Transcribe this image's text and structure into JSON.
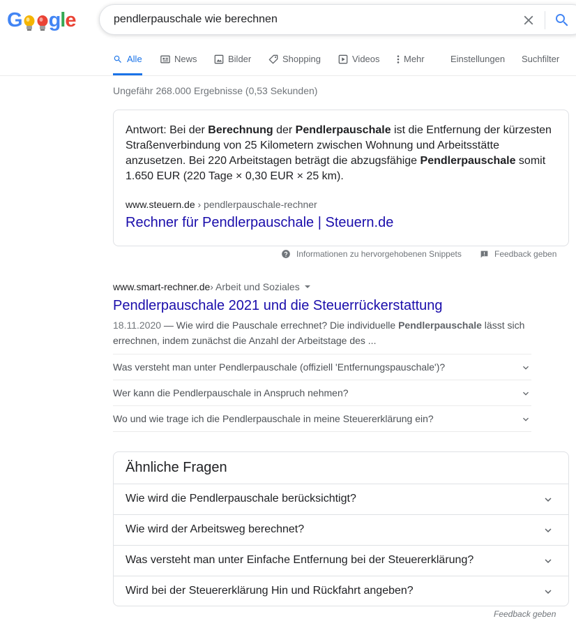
{
  "logo": {
    "letters": [
      "G",
      "o",
      "o",
      "g",
      "l",
      "e"
    ]
  },
  "search": {
    "query": "pendlerpauschale wie berechnen"
  },
  "tabs": [
    {
      "label": "Alle",
      "icon": "search-icon"
    },
    {
      "label": "News",
      "icon": "news-icon"
    },
    {
      "label": "Bilder",
      "icon": "image-icon"
    },
    {
      "label": "Shopping",
      "icon": "tag-icon"
    },
    {
      "label": "Videos",
      "icon": "play-icon"
    },
    {
      "label": "Mehr",
      "icon": "more-vert-icon"
    }
  ],
  "tools": {
    "settings": "Einstellungen",
    "filter": "Suchfilter"
  },
  "result_stats": "Ungefähr 268.000 Ergebnisse (0,53 Sekunden)",
  "featured_snippet": {
    "t1": "Antwort: Bei der ",
    "b1": "Berechnung",
    "t2": " der ",
    "b2": "Pendlerpauschale",
    "t3": " ist die Entfernung der kürzesten Straßenverbindung von 25 Kilometern zwischen Wohnung und Arbeitsstätte anzusetzen. Bei 220 Arbeitstagen beträgt die abzugsfähige ",
    "b3": "Pendlerpauschale",
    "t4": " somit 1.650 EUR (220 Tage × 0,30 EUR × 25 km).",
    "cite_domain": "www.steuern.de",
    "cite_path": " › pendlerpauschale-rechner",
    "title": "Rechner für Pendlerpauschale | Steuern.de",
    "info": "Informationen zu hervorgehobenen Snippets",
    "feedback": "Feedback geben"
  },
  "result": {
    "cite_domain": "www.smart-rechner.de",
    "cite_path": " › Arbeit und Soziales",
    "title": "Pendlerpauschale 2021 und die Steuerrückerstattung",
    "date": "18.11.2020",
    "d1": " — Wie wird die Pauschale errechnet? Die individuelle ",
    "b1": "Pendlerpauschale",
    "d2": " lässt sich errechnen, indem zunächst die Anzahl der Arbeitstage des ...",
    "faqs": [
      "Was versteht man unter Pendlerpauschale (offiziell 'Entfernungspauschale')?",
      "Wer kann die Pendlerpauschale in Anspruch nehmen?",
      "Wo und wie trage ich die Pendlerpauschale in meine Steuererklärung ein?"
    ]
  },
  "paa": {
    "title": "Ähnliche Fragen",
    "questions": [
      "Wie wird die Pendlerpauschale berücksichtigt?",
      "Wie wird der Arbeitsweg berechnet?",
      "Was versteht man unter Einfache Entfernung bei der Steuererklärung?",
      "Wird bei der Steuererklärung Hin und Rückfahrt angeben?"
    ]
  },
  "feedback_bottom": "Feedback geben",
  "colors": {
    "accent": "#1a73e8",
    "link": "#1a0dab",
    "logo_blue": "#4285f4",
    "logo_red": "#ea4335",
    "logo_yellow": "#fbbc05",
    "logo_green": "#34a853"
  }
}
